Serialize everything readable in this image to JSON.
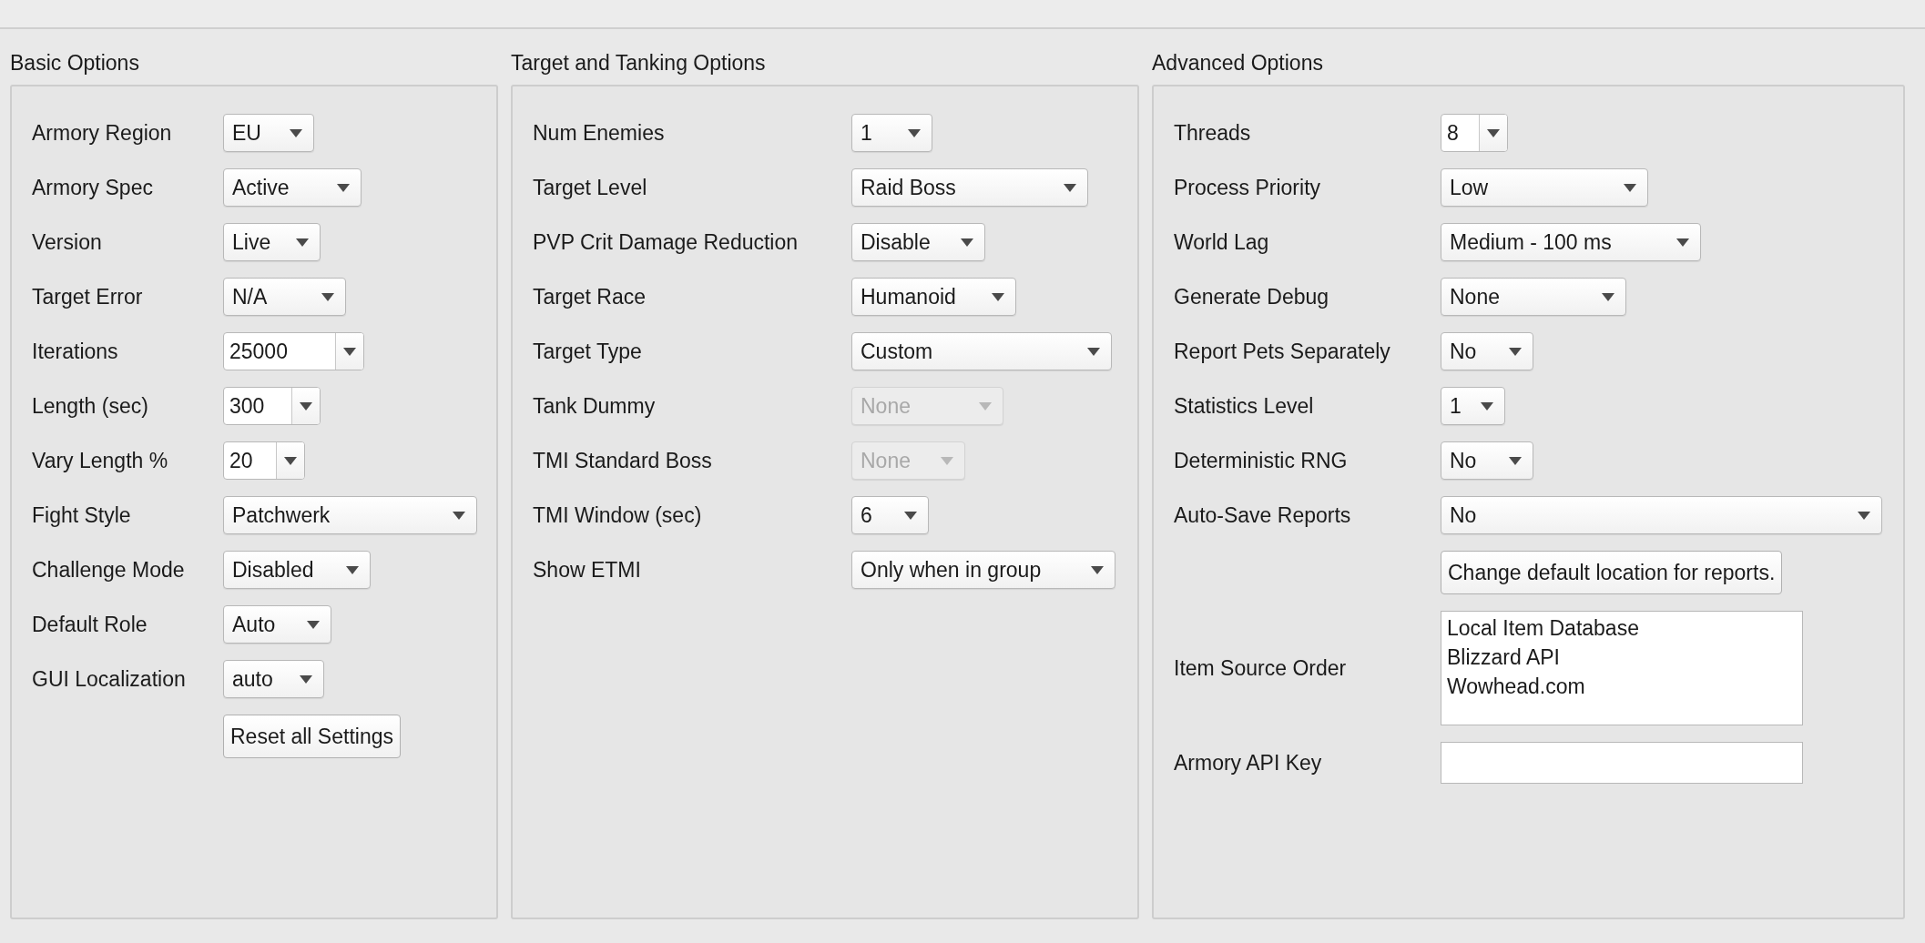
{
  "panels": [
    {
      "title": "Basic Options",
      "rows": [
        {
          "label": "Armory Region",
          "control": {
            "kind": "select",
            "value": "EU",
            "disabled": false
          }
        },
        {
          "label": "Armory Spec",
          "control": {
            "kind": "select",
            "value": "Active",
            "disabled": false
          }
        },
        {
          "label": "Version",
          "control": {
            "kind": "select",
            "value": "Live",
            "disabled": false
          }
        },
        {
          "label": "Target Error",
          "control": {
            "kind": "select",
            "value": "N/A",
            "disabled": false
          }
        },
        {
          "label": "Iterations",
          "control": {
            "kind": "editable",
            "value": "25000",
            "disabled": false
          }
        },
        {
          "label": "Length (sec)",
          "control": {
            "kind": "editable",
            "value": "300",
            "disabled": false
          }
        },
        {
          "label": "Vary Length %",
          "control": {
            "kind": "editable",
            "value": "20",
            "disabled": false
          }
        },
        {
          "label": "Fight Style",
          "control": {
            "kind": "select",
            "value": "Patchwerk",
            "disabled": false
          }
        },
        {
          "label": "Challenge Mode",
          "control": {
            "kind": "select",
            "value": "Disabled",
            "disabled": false
          }
        },
        {
          "label": "Default Role",
          "control": {
            "kind": "select",
            "value": "Auto",
            "disabled": false
          }
        },
        {
          "label": "GUI Localization",
          "control": {
            "kind": "select",
            "value": "auto",
            "disabled": false
          }
        },
        {
          "control": {
            "kind": "button",
            "value": "Reset all Settings"
          }
        }
      ]
    },
    {
      "title": "Target and Tanking Options",
      "rows": [
        {
          "label": "Num Enemies",
          "control": {
            "kind": "select",
            "value": "1",
            "disabled": false
          }
        },
        {
          "label": "Target Level",
          "control": {
            "kind": "select",
            "value": "Raid Boss",
            "disabled": false
          }
        },
        {
          "label": "PVP Crit Damage Reduction",
          "control": {
            "kind": "select",
            "value": "Disable",
            "disabled": false
          }
        },
        {
          "label": "Target Race",
          "control": {
            "kind": "select",
            "value": "Humanoid",
            "disabled": false
          }
        },
        {
          "label": "Target Type",
          "control": {
            "kind": "select",
            "value": "Custom",
            "disabled": false
          }
        },
        {
          "label": "Tank Dummy",
          "control": {
            "kind": "select",
            "value": "None",
            "disabled": true
          }
        },
        {
          "label": "TMI Standard Boss",
          "control": {
            "kind": "select",
            "value": "None",
            "disabled": true
          }
        },
        {
          "label": "TMI Window (sec)",
          "control": {
            "kind": "select",
            "value": "6",
            "disabled": false
          }
        },
        {
          "label": "Show ETMI",
          "control": {
            "kind": "select",
            "value": "Only when in group",
            "disabled": false
          }
        }
      ]
    },
    {
      "title": "Advanced Options",
      "rows": [
        {
          "label": "Threads",
          "control": {
            "kind": "editable",
            "value": "8",
            "disabled": false
          }
        },
        {
          "label": "Process Priority",
          "control": {
            "kind": "select",
            "value": "Low",
            "disabled": false
          }
        },
        {
          "label": "World Lag",
          "control": {
            "kind": "select",
            "value": "Medium - 100 ms",
            "disabled": false
          }
        },
        {
          "label": "Generate Debug",
          "control": {
            "kind": "select",
            "value": "None",
            "disabled": false
          }
        },
        {
          "label": "Report Pets Separately",
          "control": {
            "kind": "select",
            "value": "No",
            "disabled": false
          }
        },
        {
          "label": "Statistics Level",
          "control": {
            "kind": "select",
            "value": "1",
            "disabled": false
          }
        },
        {
          "label": "Deterministic RNG",
          "control": {
            "kind": "select",
            "value": "No",
            "disabled": false
          }
        },
        {
          "label": "Auto-Save Reports",
          "control": {
            "kind": "select",
            "value": "No",
            "disabled": false
          }
        },
        {
          "control": {
            "kind": "button",
            "value": "Change default location for reports."
          }
        },
        {
          "label": "Item Source Order",
          "control": {
            "kind": "list",
            "items": [
              "Local Item Database",
              "Blizzard API",
              "Wowhead.com"
            ]
          }
        },
        {
          "label": "Armory API Key",
          "control": {
            "kind": "text"
          }
        }
      ]
    }
  ]
}
